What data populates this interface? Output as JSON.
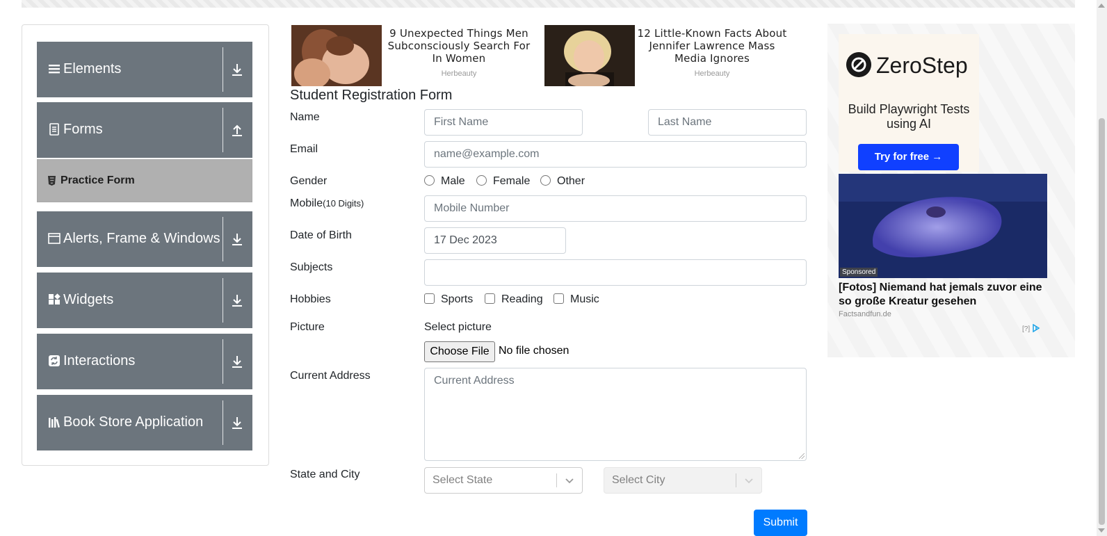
{
  "sidebar": {
    "groups": [
      {
        "label": "Elements",
        "icon": "list-icon",
        "arrow": "down"
      },
      {
        "label": "Forms",
        "icon": "document-icon",
        "arrow": "up"
      },
      {
        "label": "Alerts, Frame & Windows",
        "icon": "window-icon",
        "arrow": "down"
      },
      {
        "label": "Widgets",
        "icon": "widgets-icon",
        "arrow": "down"
      },
      {
        "label": "Interactions",
        "icon": "sync-icon",
        "arrow": "down"
      },
      {
        "label": "Book Store Application",
        "icon": "books-icon",
        "arrow": "down"
      }
    ],
    "active_item": "Practice Form"
  },
  "ads": {
    "top": [
      {
        "title": "9 Unexpected Things Men Subconsciously Search For In Women",
        "source": "Herbeauty"
      },
      {
        "title": "12 Little-Known Facts About Jennifer Lawrence Mass Media Ignores",
        "source": "Herbeauty"
      }
    ],
    "side": {
      "brand": "ZeroStep",
      "tagline": "Build Playwright Tests using AI",
      "cta": "Try for free →",
      "sponsored": "Sponsored",
      "title": "[Fotos] Niemand hat jemals zuvor eine so große Kreatur gesehen",
      "source": "Factsandfun.de",
      "help": "[?]"
    }
  },
  "form": {
    "title": "Student Registration Form",
    "labels": {
      "name": "Name",
      "email": "Email",
      "gender": "Gender",
      "mobile": "Mobile",
      "mobile_hint": "(10 Digits)",
      "dob": "Date of Birth",
      "subjects": "Subjects",
      "hobbies": "Hobbies",
      "picture": "Picture",
      "address": "Current Address",
      "state_city": "State and City"
    },
    "placeholders": {
      "first_name": "First Name",
      "last_name": "Last Name",
      "email": "name@example.com",
      "mobile": "Mobile Number",
      "address": "Current Address"
    },
    "dob_value": "17 Dec 2023",
    "gender_options": [
      "Male",
      "Female",
      "Other"
    ],
    "hobby_options": [
      "Sports",
      "Reading",
      "Music"
    ],
    "picture_heading": "Select picture",
    "file_button": "Choose File",
    "file_status": "No file chosen",
    "state_placeholder": "Select State",
    "city_placeholder": "Select City",
    "submit": "Submit"
  },
  "colors": {
    "sidebar_group": "#6c757d",
    "sidebar_active": "#b0b0b0",
    "primary": "#007bff",
    "cta": "#1040ff"
  }
}
